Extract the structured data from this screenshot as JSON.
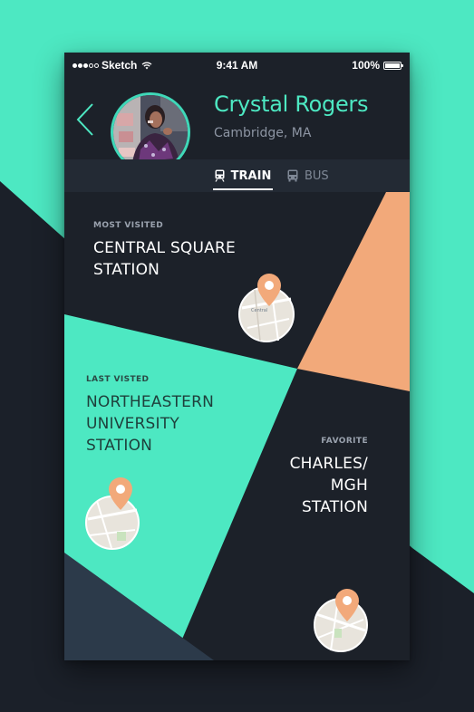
{
  "status_bar": {
    "carrier": "Sketch",
    "time": "9:41 AM",
    "battery": "100%"
  },
  "profile": {
    "name": "Crystal Rogers",
    "location": "Cambridge, MA"
  },
  "tabs": [
    {
      "label": "TRAIN",
      "icon": "train-icon",
      "active": true
    },
    {
      "label": "BUS",
      "icon": "bus-icon",
      "active": false
    }
  ],
  "cards": {
    "most_visited": {
      "label": "MOST VISITED",
      "title_lines": [
        "CENTRAL SQUARE",
        "STATION"
      ],
      "map_text": "Central"
    },
    "last_visited": {
      "label": "LAST VISTED",
      "title_lines": [
        "NORTHEASTERN",
        "UNIVERSITY",
        "STATION"
      ]
    },
    "favorite": {
      "label": "FAVORITE",
      "title_lines": [
        "CHARLES/",
        "MGH",
        "STATION"
      ]
    }
  },
  "colors": {
    "accent_teal": "#4de8c2",
    "accent_orange": "#f2a97a",
    "dark_bg": "#1c2129",
    "slate": "#2c3a4a"
  }
}
